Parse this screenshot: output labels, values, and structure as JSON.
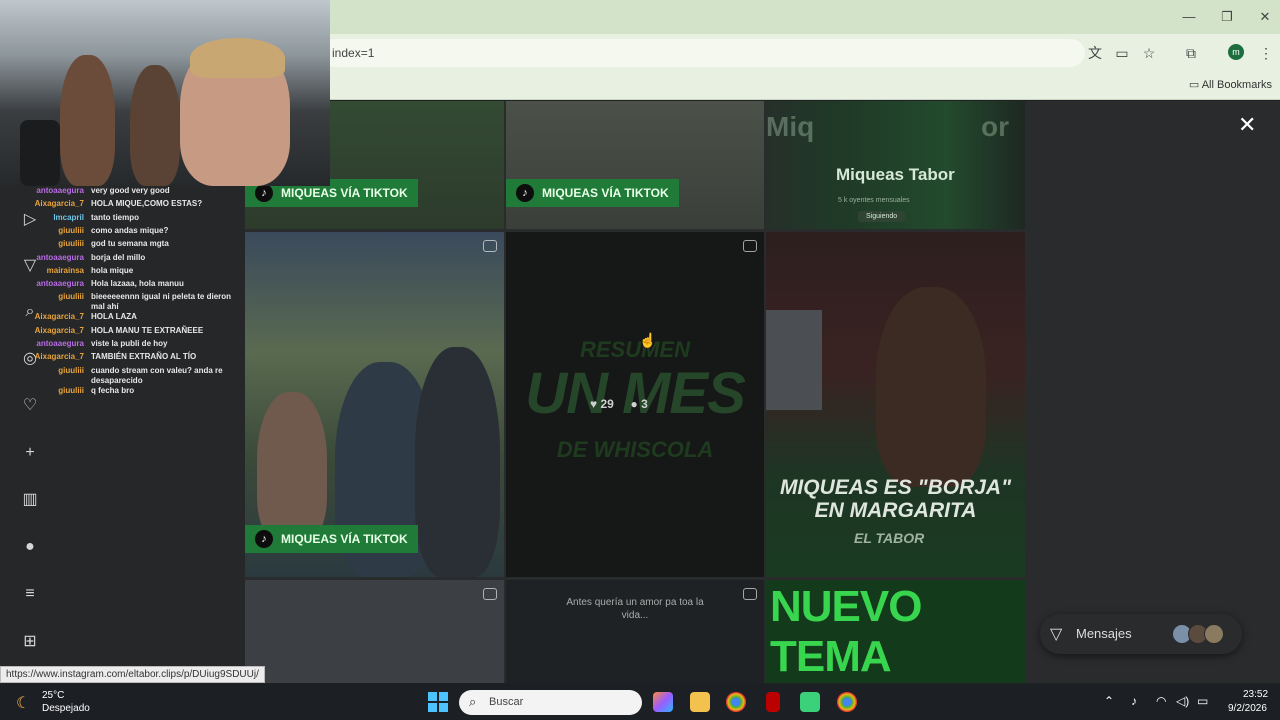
{
  "browser": {
    "url_fragment": "index=1",
    "bookmarks_label": "All Bookmarks",
    "profile_initial": "m"
  },
  "tiles": {
    "badge_label": "MIQUEAS VÍA TIKTOK",
    "spotify_title": "Miqueas Tabor",
    "spotify_sub": "5 k oyentes mensuales",
    "spotify_follow": "Siguiendo",
    "resumen": "RESUMEN",
    "un_mes": "UN MES",
    "de_whiscola": "DE WHISCOLA",
    "likes": "29",
    "comments": "3",
    "borja_line1": "MIQUEAS ES \"BORJA\"",
    "borja_line2": "EN MARGARITA",
    "brand": "EL TABOR",
    "post_caption_1": "Antes quería un amor pa toa la",
    "post_caption_2": "vida... ",
    "nuevo_tema": "NUEVO TEMA"
  },
  "messages": {
    "label": "Mensajes"
  },
  "chat": [
    {
      "user": "antoaaegura",
      "msg": "very good very good",
      "color": "#b96ce6"
    },
    {
      "user": "Aixagarcia_7",
      "msg": "HOLA MIQUE,COMO ESTAS?",
      "color": "#e8a33a"
    },
    {
      "user": "lmcapril",
      "msg": "tanto tiempo",
      "color": "#6ec3e6"
    },
    {
      "user": "giuuliii",
      "msg": "como andas mique?",
      "color": "#e8a33a"
    },
    {
      "user": "giuuliii",
      "msg": "god tu semana mgta",
      "color": "#e8a33a"
    },
    {
      "user": "antoaaegura",
      "msg": "borja del millo",
      "color": "#b96ce6"
    },
    {
      "user": "mairainsa",
      "msg": "hola mique",
      "color": "#e8a33a"
    },
    {
      "user": "antoaaegura",
      "msg": "Hola lazaaa, hola manuu",
      "color": "#b96ce6"
    },
    {
      "user": "giuuliii",
      "msg": "bieeeeeennn igual ni peleta te dieron mal ahí",
      "color": "#e8a33a"
    },
    {
      "user": "Aixagarcia_7",
      "msg": "HOLA LAZA",
      "color": "#e8a33a"
    },
    {
      "user": "Aixagarcia_7",
      "msg": "HOLA MANU TE EXTRAÑEEE",
      "color": "#e8a33a"
    },
    {
      "user": "antoaaegura",
      "msg": "viste la publi de hoy",
      "color": "#b96ce6"
    },
    {
      "user": "Aixagarcia_7",
      "msg": "TAMBIÉN EXTRAÑO AL TÍO",
      "color": "#e8a33a"
    },
    {
      "user": "giuuliii",
      "msg": "cuando stream con valeu? anda re desaparecido",
      "color": "#e8a33a"
    },
    {
      "user": "giuuliii",
      "msg": "q fecha bro",
      "color": "#e8a33a"
    }
  ],
  "status_url": "https://www.instagram.com/eltabor.clips/p/DUiug9SDUUj/",
  "taskbar": {
    "temp": "25°C",
    "weather": "Despejado",
    "search_placeholder": "Buscar",
    "time": "23:52",
    "date": "9/2/2026"
  }
}
